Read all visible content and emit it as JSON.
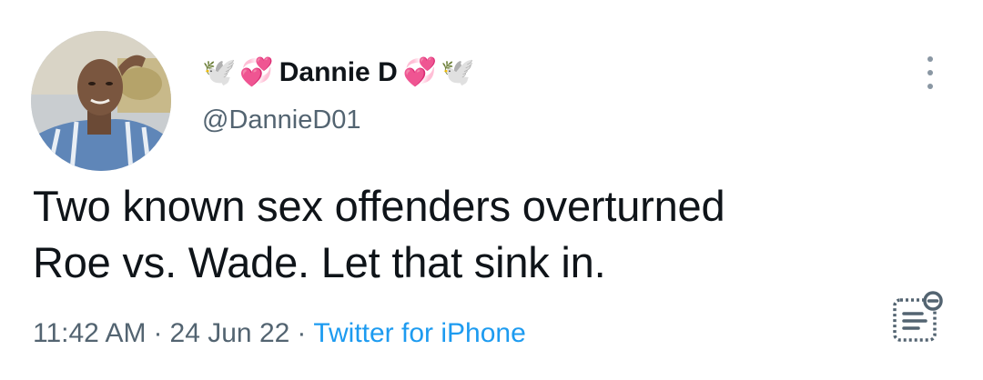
{
  "author": {
    "name_prefix_emoji": [
      "🕊️",
      "💞"
    ],
    "display_name": "Dannie D",
    "name_suffix_emoji": [
      "💞",
      "🕊️"
    ],
    "handle": "@DannieD01"
  },
  "tweet": {
    "text_line1": "Two known sex offenders overturned",
    "text_line2": "Roe vs. Wade. Let that sink in."
  },
  "meta": {
    "time": "11:42 AM",
    "separator": "·",
    "date": "24 Jun 22",
    "source": "Twitter for iPhone"
  },
  "icons": {
    "more": "more-vertical-icon",
    "activity": "tweet-analytics-icon"
  },
  "colors": {
    "text_primary": "#0f1419",
    "text_secondary": "#536471",
    "link": "#1d9bf0"
  }
}
